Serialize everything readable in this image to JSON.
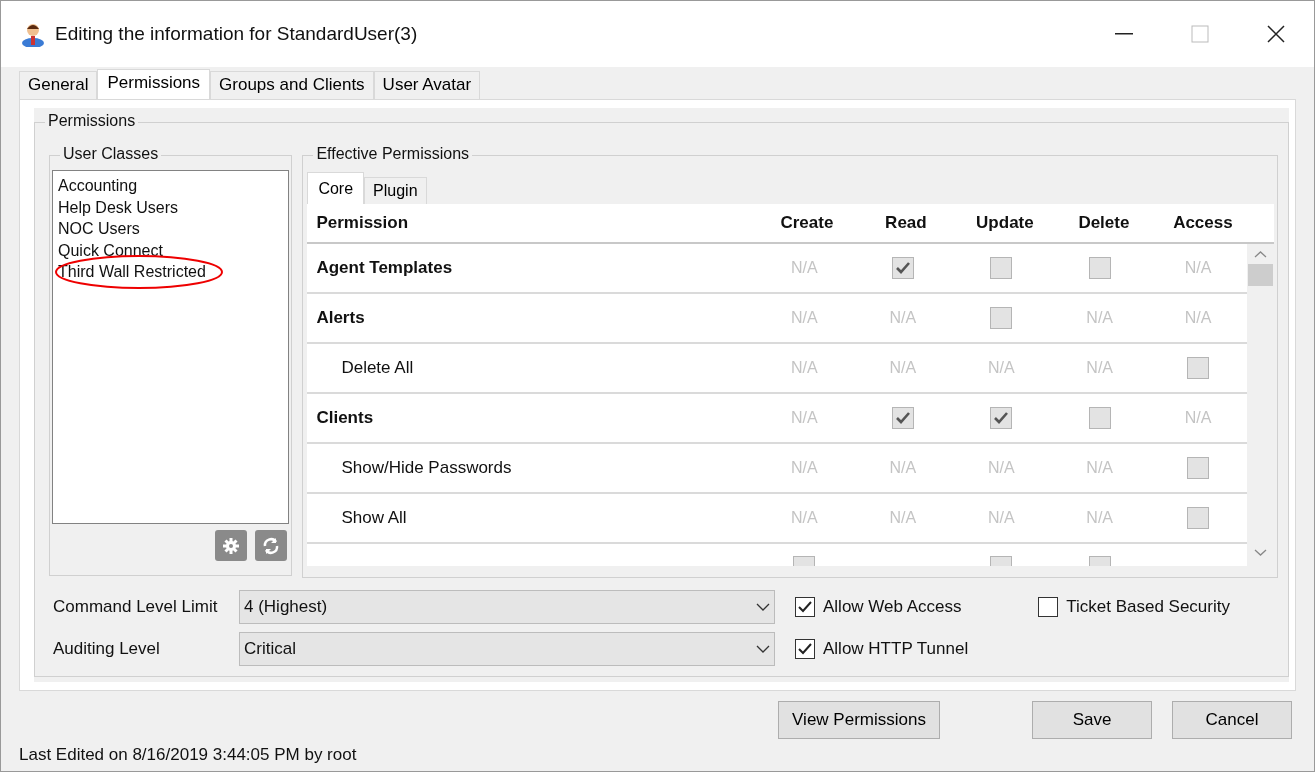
{
  "window": {
    "title": "Editing the information for StandardUser(3)"
  },
  "tabs": [
    {
      "label": "General",
      "selected": false
    },
    {
      "label": "Permissions",
      "selected": true
    },
    {
      "label": "Groups and Clients",
      "selected": false
    },
    {
      "label": "User Avatar",
      "selected": false
    }
  ],
  "permissions_group": {
    "title": "Permissions"
  },
  "user_classes": {
    "title": "User Classes",
    "items": [
      {
        "label": "Accounting",
        "highlighted": false
      },
      {
        "label": "Help Desk Users",
        "highlighted": false
      },
      {
        "label": "NOC Users",
        "highlighted": false
      },
      {
        "label": "Quick Connect",
        "highlighted": false
      },
      {
        "label": "Third Wall Restricted",
        "highlighted": true
      }
    ]
  },
  "effective_permissions": {
    "title": "Effective Permissions",
    "tabs": [
      {
        "label": "Core",
        "selected": true
      },
      {
        "label": "Plugin",
        "selected": false
      }
    ],
    "name_column": "Permission",
    "columns": [
      "Create",
      "Read",
      "Update",
      "Delete",
      "Access"
    ],
    "rows": [
      {
        "name": "Agent Templates",
        "kind": "parent",
        "cells": [
          {
            "kind": "na",
            "text": "N/A"
          },
          {
            "kind": "checkbox",
            "checked": true
          },
          {
            "kind": "checkbox",
            "checked": false
          },
          {
            "kind": "checkbox",
            "checked": false
          },
          {
            "kind": "na",
            "text": "N/A"
          }
        ]
      },
      {
        "name": "Alerts",
        "kind": "parent",
        "cells": [
          {
            "kind": "na",
            "text": "N/A"
          },
          {
            "kind": "na",
            "text": "N/A"
          },
          {
            "kind": "checkbox",
            "checked": false
          },
          {
            "kind": "na",
            "text": "N/A"
          },
          {
            "kind": "na",
            "text": "N/A"
          }
        ]
      },
      {
        "name": "Delete All",
        "kind": "child",
        "cells": [
          {
            "kind": "na",
            "text": "N/A"
          },
          {
            "kind": "na",
            "text": "N/A"
          },
          {
            "kind": "na",
            "text": "N/A"
          },
          {
            "kind": "na",
            "text": "N/A"
          },
          {
            "kind": "checkbox",
            "checked": false
          }
        ]
      },
      {
        "name": "Clients",
        "kind": "parent",
        "cells": [
          {
            "kind": "na",
            "text": "N/A"
          },
          {
            "kind": "checkbox",
            "checked": true
          },
          {
            "kind": "checkbox",
            "checked": true
          },
          {
            "kind": "checkbox",
            "checked": false
          },
          {
            "kind": "na",
            "text": "N/A"
          }
        ]
      },
      {
        "name": "Show/Hide Passwords",
        "kind": "child",
        "cells": [
          {
            "kind": "na",
            "text": "N/A"
          },
          {
            "kind": "na",
            "text": "N/A"
          },
          {
            "kind": "na",
            "text": "N/A"
          },
          {
            "kind": "na",
            "text": "N/A"
          },
          {
            "kind": "checkbox",
            "checked": false
          }
        ]
      },
      {
        "name": "Show All",
        "kind": "child",
        "cells": [
          {
            "kind": "na",
            "text": "N/A"
          },
          {
            "kind": "na",
            "text": "N/A"
          },
          {
            "kind": "na",
            "text": "N/A"
          },
          {
            "kind": "na",
            "text": "N/A"
          },
          {
            "kind": "checkbox",
            "checked": false
          }
        ]
      },
      {
        "kind": "partial",
        "cells": [
          {
            "kind": "checkbox",
            "checked": false
          },
          {
            "kind": "blank"
          },
          {
            "kind": "checkbox",
            "checked": false
          },
          {
            "kind": "checkbox",
            "checked": false
          },
          {
            "kind": "blank"
          }
        ]
      }
    ]
  },
  "fields": [
    {
      "label": "Command Level Limit",
      "value": "4 (Highest)"
    },
    {
      "label": "Auditing Level",
      "value": "Critical"
    }
  ],
  "checkboxes": [
    {
      "label": "Allow Web Access",
      "checked": true
    },
    {
      "label": "Allow HTTP Tunnel",
      "checked": true
    },
    {
      "label": "Ticket Based Security",
      "checked": false
    }
  ],
  "buttons": [
    {
      "label": "View Permissions"
    },
    {
      "label": "Save"
    },
    {
      "label": "Cancel"
    }
  ],
  "status_bar": "Last Edited on 8/16/2019 3:44:05 PM by root"
}
